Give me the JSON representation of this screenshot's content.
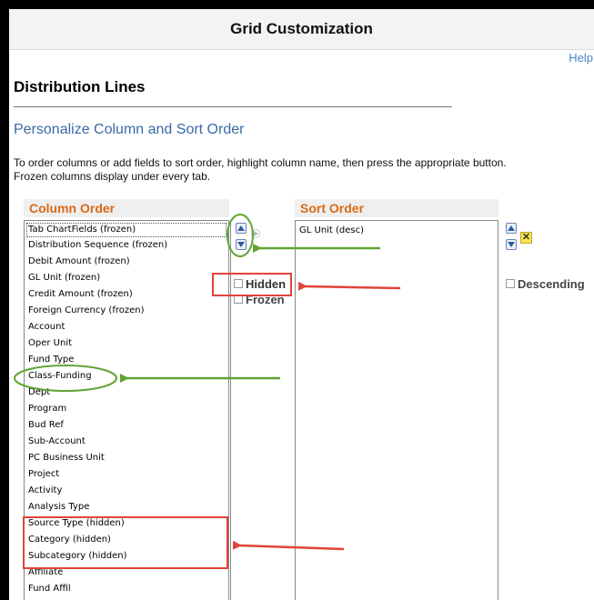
{
  "window": {
    "title": "Grid Customization",
    "help_link": "Help"
  },
  "page": {
    "section_title": "Distribution Lines",
    "subtitle": "Personalize Column and Sort Order",
    "instructions_line1": "To order columns or add fields to sort order, highlight column name, then press the appropriate button.",
    "instructions_line2": "Frozen columns display under every tab."
  },
  "column_order": {
    "header": "Column Order",
    "items": [
      "Tab ChartFields (frozen)",
      "Distribution Sequence (frozen)",
      "Debit Amount (frozen)",
      "GL Unit (frozen)",
      "Credit Amount (frozen)",
      "Foreign Currency (frozen)",
      "Account",
      "Oper Unit",
      "Fund Type",
      "Class-Funding",
      "Dept",
      "Program",
      "Bud Ref",
      "Sub-Account",
      "PC Business Unit",
      "Project",
      "Activity",
      "Analysis Type",
      "Source Type (hidden)",
      "Category (hidden)",
      "Subcategory (hidden)",
      "Affiliate",
      "Fund Affil"
    ],
    "hidden_label": "Hidden",
    "frozen_label": "Frozen"
  },
  "sort_order": {
    "header": "Sort Order",
    "items": [
      "GL Unit (desc)"
    ],
    "descending_label": "Descending",
    "remove_symbol": "✕"
  },
  "annotation_colors": {
    "green": "#5fa532",
    "red": "#e0443a"
  }
}
